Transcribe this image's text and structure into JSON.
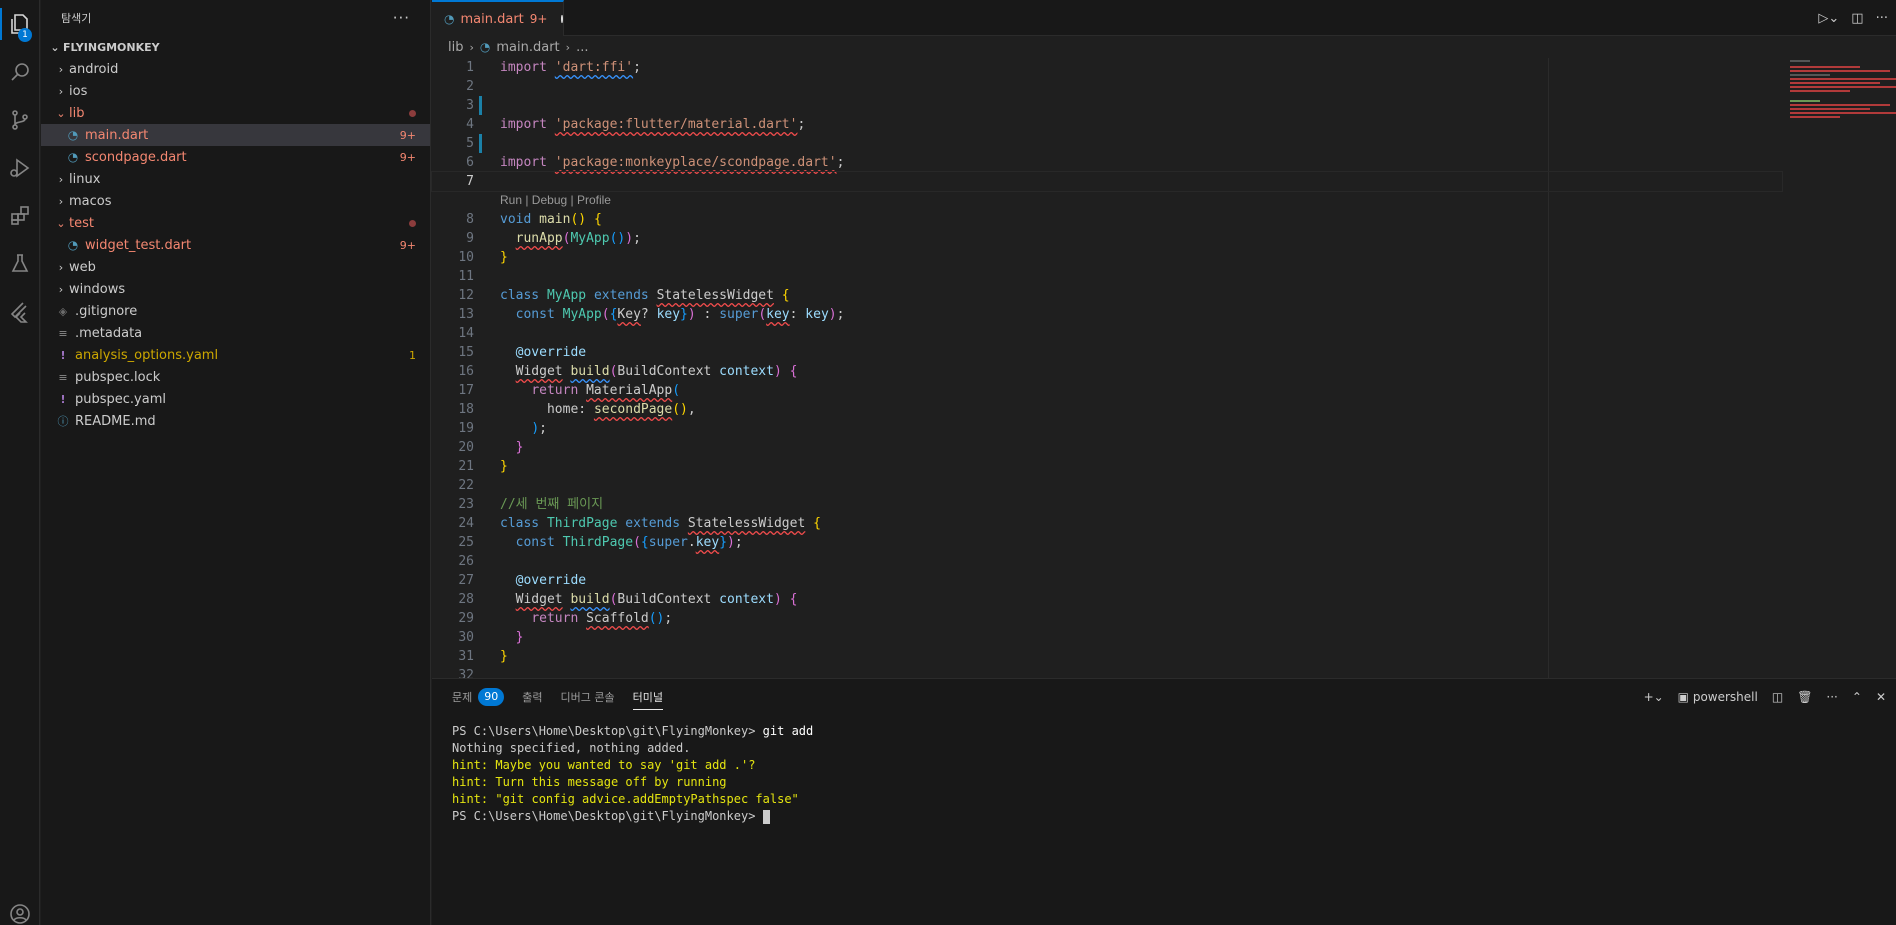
{
  "activity_bar": {
    "explorer_badge": "1",
    "items": [
      "files-icon",
      "search-icon",
      "source-control-icon",
      "run-debug-icon",
      "extensions-icon",
      "testing-icon",
      "flutter-icon",
      "account-icon"
    ]
  },
  "sidebar": {
    "title": "탐색기",
    "more": "···",
    "root": "FLYINGMONKEY",
    "tree": [
      {
        "name": "android",
        "type": "folder",
        "state": "closed"
      },
      {
        "name": "ios",
        "type": "folder",
        "state": "closed"
      },
      {
        "name": "lib",
        "type": "folder",
        "state": "open",
        "status": "error-dot"
      },
      {
        "name": "main.dart",
        "type": "dart",
        "count": "9+",
        "selected": true
      },
      {
        "name": "scondpage.dart",
        "type": "dart",
        "count": "9+"
      },
      {
        "name": "linux",
        "type": "folder",
        "state": "closed"
      },
      {
        "name": "macos",
        "type": "folder",
        "state": "closed"
      },
      {
        "name": "test",
        "type": "folder",
        "state": "open",
        "status": "error-dot"
      },
      {
        "name": "widget_test.dart",
        "type": "dart",
        "count": "9+"
      },
      {
        "name": "web",
        "type": "folder",
        "state": "closed"
      },
      {
        "name": "windows",
        "type": "folder",
        "state": "closed"
      },
      {
        "name": ".gitignore",
        "type": "git"
      },
      {
        "name": ".metadata",
        "type": "lines"
      },
      {
        "name": "analysis_options.yaml",
        "type": "yaml",
        "count": "1"
      },
      {
        "name": "pubspec.lock",
        "type": "lines"
      },
      {
        "name": "pubspec.yaml",
        "type": "yaml"
      },
      {
        "name": "README.md",
        "type": "info"
      }
    ]
  },
  "editor": {
    "tab": {
      "name": "main.dart",
      "count": "9+"
    },
    "breadcrumb": [
      "lib",
      "main.dart",
      "..."
    ],
    "codelens": "Run | Debug | Profile",
    "comment_text": "//세 번째 페이지"
  },
  "panel": {
    "tabs": [
      {
        "label": "문제",
        "badge": "90"
      },
      {
        "label": "출력"
      },
      {
        "label": "디버그 콘솔"
      },
      {
        "label": "터미널",
        "active": true
      }
    ],
    "shell": "powershell",
    "terminal_lines": [
      {
        "text": "PS C:\\Users\\Home\\Desktop\\git\\FlyingMonkey> ",
        "cmd": "git add",
        "style": "normal"
      },
      {
        "text": "Nothing specified, nothing added.",
        "style": "normal"
      },
      {
        "text": "hint: Maybe you wanted to say 'git add .'?",
        "style": "yellow"
      },
      {
        "text": "hint: Turn this message off by running",
        "style": "yellow"
      },
      {
        "text": "hint: \"git config advice.addEmptyPathspec false\"",
        "style": "yellow"
      },
      {
        "text": "PS C:\\Users\\Home\\Desktop\\git\\FlyingMonkey> ",
        "style": "prompt"
      }
    ]
  }
}
